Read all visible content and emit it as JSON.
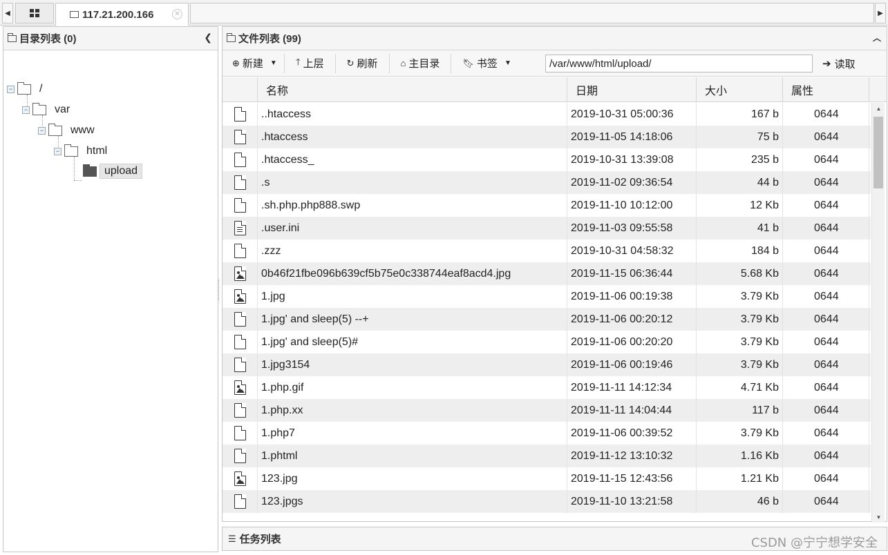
{
  "tabs": {
    "host": "117.21.200.166"
  },
  "dir_panel": {
    "title": "目录列表 (0)",
    "tree": [
      {
        "label": "/"
      },
      {
        "label": "var"
      },
      {
        "label": "www"
      },
      {
        "label": "html"
      },
      {
        "label": "upload"
      }
    ]
  },
  "file_panel": {
    "title": "文件列表 (99)",
    "toolbar": {
      "new_label": "新建",
      "up_label": "上层",
      "refresh_label": "刷新",
      "home_label": "主目录",
      "bookmark_label": "书签",
      "path_value": "/var/www/html/upload/",
      "read_label": "读取"
    },
    "columns": {
      "name": "名称",
      "date": "日期",
      "size": "大小",
      "attr": "属性"
    },
    "rows": [
      {
        "icon": "file",
        "name": "..htaccess",
        "date": "2019-10-31 05:00:36",
        "size": "167 b",
        "attr": "0644"
      },
      {
        "icon": "file",
        "name": ".htaccess",
        "date": "2019-11-05 14:18:06",
        "size": "75 b",
        "attr": "0644"
      },
      {
        "icon": "file",
        "name": ".htaccess_",
        "date": "2019-10-31 13:39:08",
        "size": "235 b",
        "attr": "0644"
      },
      {
        "icon": "file",
        "name": ".s",
        "date": "2019-11-02 09:36:54",
        "size": "44 b",
        "attr": "0644"
      },
      {
        "icon": "file",
        "name": ".sh.php.php888.swp",
        "date": "2019-11-10 10:12:00",
        "size": "12 Kb",
        "attr": "0644"
      },
      {
        "icon": "text",
        "name": ".user.ini",
        "date": "2019-11-03 09:55:58",
        "size": "41 b",
        "attr": "0644"
      },
      {
        "icon": "file",
        "name": ".zzz",
        "date": "2019-10-31 04:58:32",
        "size": "184 b",
        "attr": "0644"
      },
      {
        "icon": "image",
        "name": "0b46f21fbe096b639cf5b75e0c338744eaf8acd4.jpg",
        "date": "2019-11-15 06:36:44",
        "size": "5.68 Kb",
        "attr": "0644"
      },
      {
        "icon": "image",
        "name": "1.jpg",
        "date": "2019-11-06 00:19:38",
        "size": "3.79 Kb",
        "attr": "0644"
      },
      {
        "icon": "file",
        "name": "1.jpg' and sleep(5) --+",
        "date": "2019-11-06 00:20:12",
        "size": "3.79 Kb",
        "attr": "0644"
      },
      {
        "icon": "file",
        "name": "1.jpg' and sleep(5)#",
        "date": "2019-11-06 00:20:20",
        "size": "3.79 Kb",
        "attr": "0644"
      },
      {
        "icon": "file",
        "name": "1.jpg3154",
        "date": "2019-11-06 00:19:46",
        "size": "3.79 Kb",
        "attr": "0644"
      },
      {
        "icon": "image",
        "name": "1.php.gif",
        "date": "2019-11-11 14:12:34",
        "size": "4.71 Kb",
        "attr": "0644"
      },
      {
        "icon": "file",
        "name": "1.php.xx",
        "date": "2019-11-11 14:04:44",
        "size": "117 b",
        "attr": "0644"
      },
      {
        "icon": "file",
        "name": "1.php7",
        "date": "2019-11-06 00:39:52",
        "size": "3.79 Kb",
        "attr": "0644"
      },
      {
        "icon": "file",
        "name": "1.phtml",
        "date": "2019-11-12 13:10:32",
        "size": "1.16 Kb",
        "attr": "0644"
      },
      {
        "icon": "image",
        "name": "123.jpg",
        "date": "2019-11-15 12:43:56",
        "size": "1.21 Kb",
        "attr": "0644"
      },
      {
        "icon": "file",
        "name": "123.jpgs",
        "date": "2019-11-10 13:21:58",
        "size": "46 b",
        "attr": "0644"
      }
    ]
  },
  "task_panel": {
    "title": "任务列表"
  },
  "watermark": "CSDN @宁宁想学安全"
}
